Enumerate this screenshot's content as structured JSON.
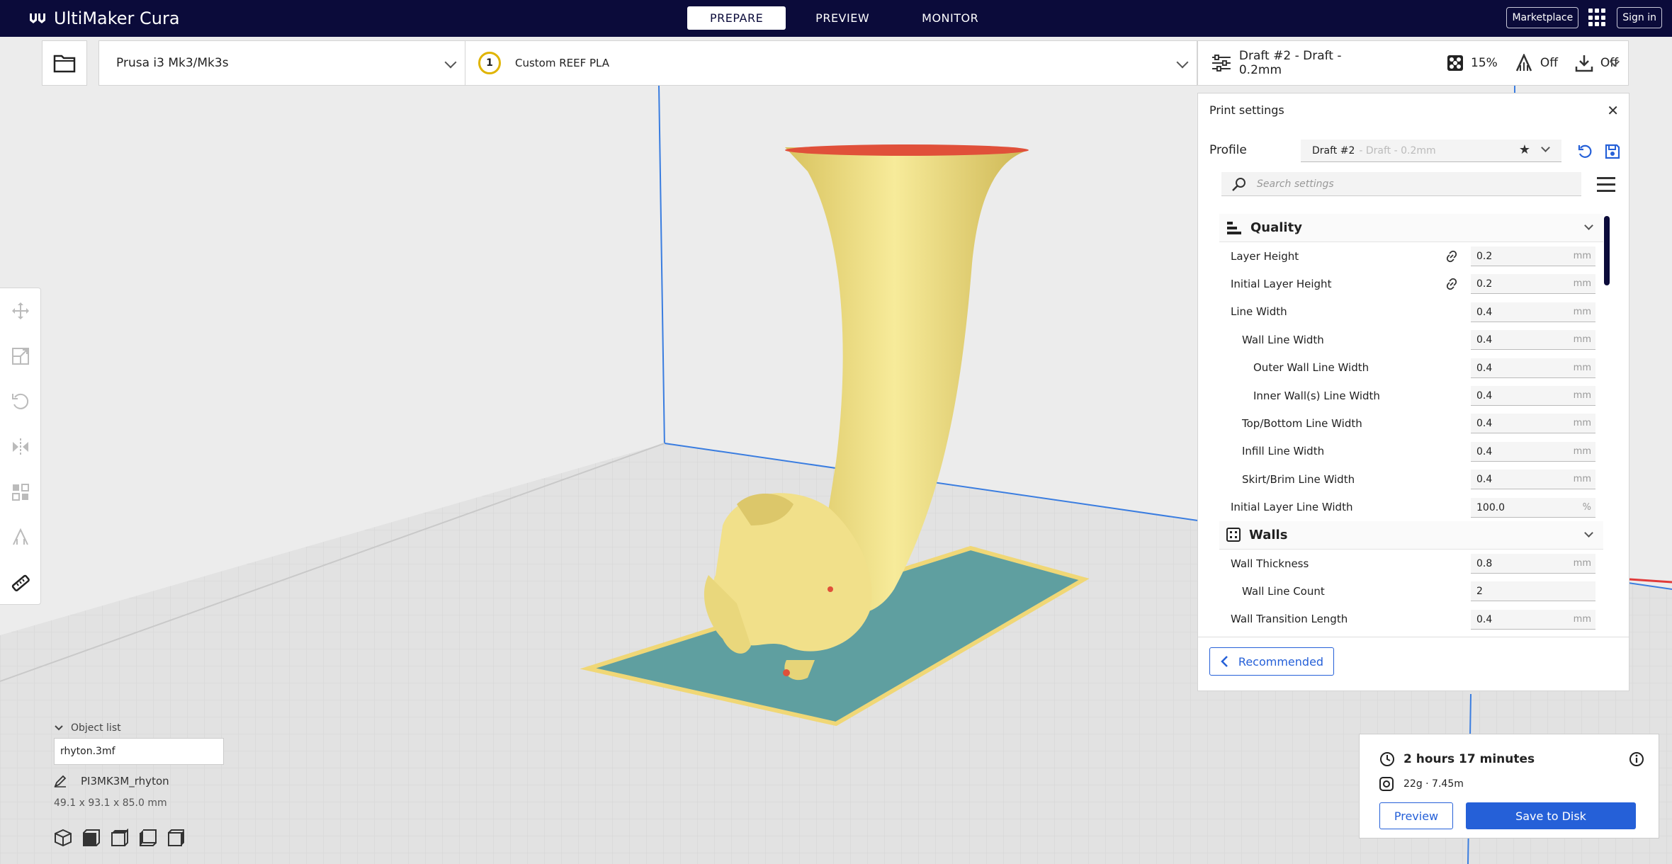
{
  "app": {
    "title": "UltiMaker Cura"
  },
  "stages": [
    {
      "label": "PREPARE",
      "active": true
    },
    {
      "label": "PREVIEW",
      "active": false
    },
    {
      "label": "MONITOR",
      "active": false
    }
  ],
  "topbar": {
    "marketplace": "Marketplace",
    "signin": "Sign in"
  },
  "header": {
    "machine": "Prusa i3 Mk3/Mk3s",
    "extruder_number": "1",
    "material": "Custom REEF PLA",
    "profile_summary": "Draft #2 - Draft - 0.2mm",
    "infill": "15%",
    "support": "Off",
    "adhesion": "Off"
  },
  "print_settings": {
    "title": "Print settings",
    "profile_label": "Profile",
    "profile_name": "Draft #2",
    "profile_suffix": "- Draft - 0.2mm",
    "search_placeholder": "Search settings",
    "categories": [
      {
        "name": "Quality",
        "rows": [
          {
            "name": "Layer Height",
            "value": "0.2",
            "unit": "mm",
            "indent": 0,
            "linked": true
          },
          {
            "name": "Initial Layer Height",
            "value": "0.2",
            "unit": "mm",
            "indent": 0,
            "linked": true
          },
          {
            "name": "Line Width",
            "value": "0.4",
            "unit": "mm",
            "indent": 0
          },
          {
            "name": "Wall Line Width",
            "value": "0.4",
            "unit": "mm",
            "indent": 1
          },
          {
            "name": "Outer Wall Line Width",
            "value": "0.4",
            "unit": "mm",
            "indent": 2
          },
          {
            "name": "Inner Wall(s) Line Width",
            "value": "0.4",
            "unit": "mm",
            "indent": 2
          },
          {
            "name": "Top/Bottom Line Width",
            "value": "0.4",
            "unit": "mm",
            "indent": 1
          },
          {
            "name": "Infill Line Width",
            "value": "0.4",
            "unit": "mm",
            "indent": 1
          },
          {
            "name": "Skirt/Brim Line Width",
            "value": "0.4",
            "unit": "mm",
            "indent": 1
          },
          {
            "name": "Initial Layer Line Width",
            "value": "100.0",
            "unit": "%",
            "indent": 0
          }
        ]
      },
      {
        "name": "Walls",
        "rows": [
          {
            "name": "Wall Thickness",
            "value": "0.8",
            "unit": "mm",
            "indent": 0
          },
          {
            "name": "Wall Line Count",
            "value": "2",
            "unit": "",
            "indent": 1
          },
          {
            "name": "Wall Transition Length",
            "value": "0.4",
            "unit": "mm",
            "indent": 0
          }
        ]
      }
    ],
    "recommended_label": "Recommended"
  },
  "object_list": {
    "header": "Object list",
    "file": "rhyton.3mf",
    "object_name": "PI3MK3M_rhyton",
    "dimensions": "49.1 x 93.1 x 85.0 mm"
  },
  "summary": {
    "time": "2 hours 17 minutes",
    "material_usage": "22g · 7.45m",
    "preview_label": "Preview",
    "save_label": "Save to Disk"
  },
  "colors": {
    "navy": "#0b0b3a",
    "accent": "#2560d8",
    "model": "#f3e48a",
    "plate": "#5f9fa0"
  }
}
